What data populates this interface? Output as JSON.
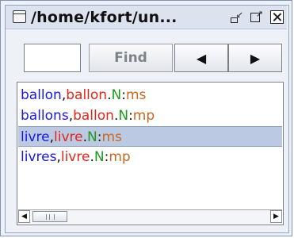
{
  "window": {
    "title": "/home/kfort/un...",
    "title_icon": "window-icon",
    "buttons": [
      "minimize-icon",
      "maximize-icon",
      "close-icon"
    ]
  },
  "toolbar": {
    "search_value": "",
    "find_label": "Find",
    "prev_icon": "◀",
    "next_icon": "▶"
  },
  "colors": {
    "word": "#1a1ae6",
    "lemma": "#e0261c",
    "pos": "#1f9a1f",
    "feature": "#c9671f",
    "separator": "#111111",
    "selected_bg": "#bcc9e2"
  },
  "results": [
    {
      "word": "ballon",
      "lemma": "ballon",
      "pos": "N",
      "feature": "ms",
      "selected": false
    },
    {
      "word": "ballons",
      "lemma": "ballon",
      "pos": "N",
      "feature": "mp",
      "selected": false
    },
    {
      "word": "livre",
      "lemma": "livre",
      "pos": "N",
      "feature": "ms",
      "selected": true
    },
    {
      "word": "livres",
      "lemma": "livre",
      "pos": "N",
      "feature": "mp",
      "selected": false
    }
  ],
  "scrollbar": {
    "left_icon": "◀",
    "right_icon": "▶",
    "position": 0.0
  }
}
